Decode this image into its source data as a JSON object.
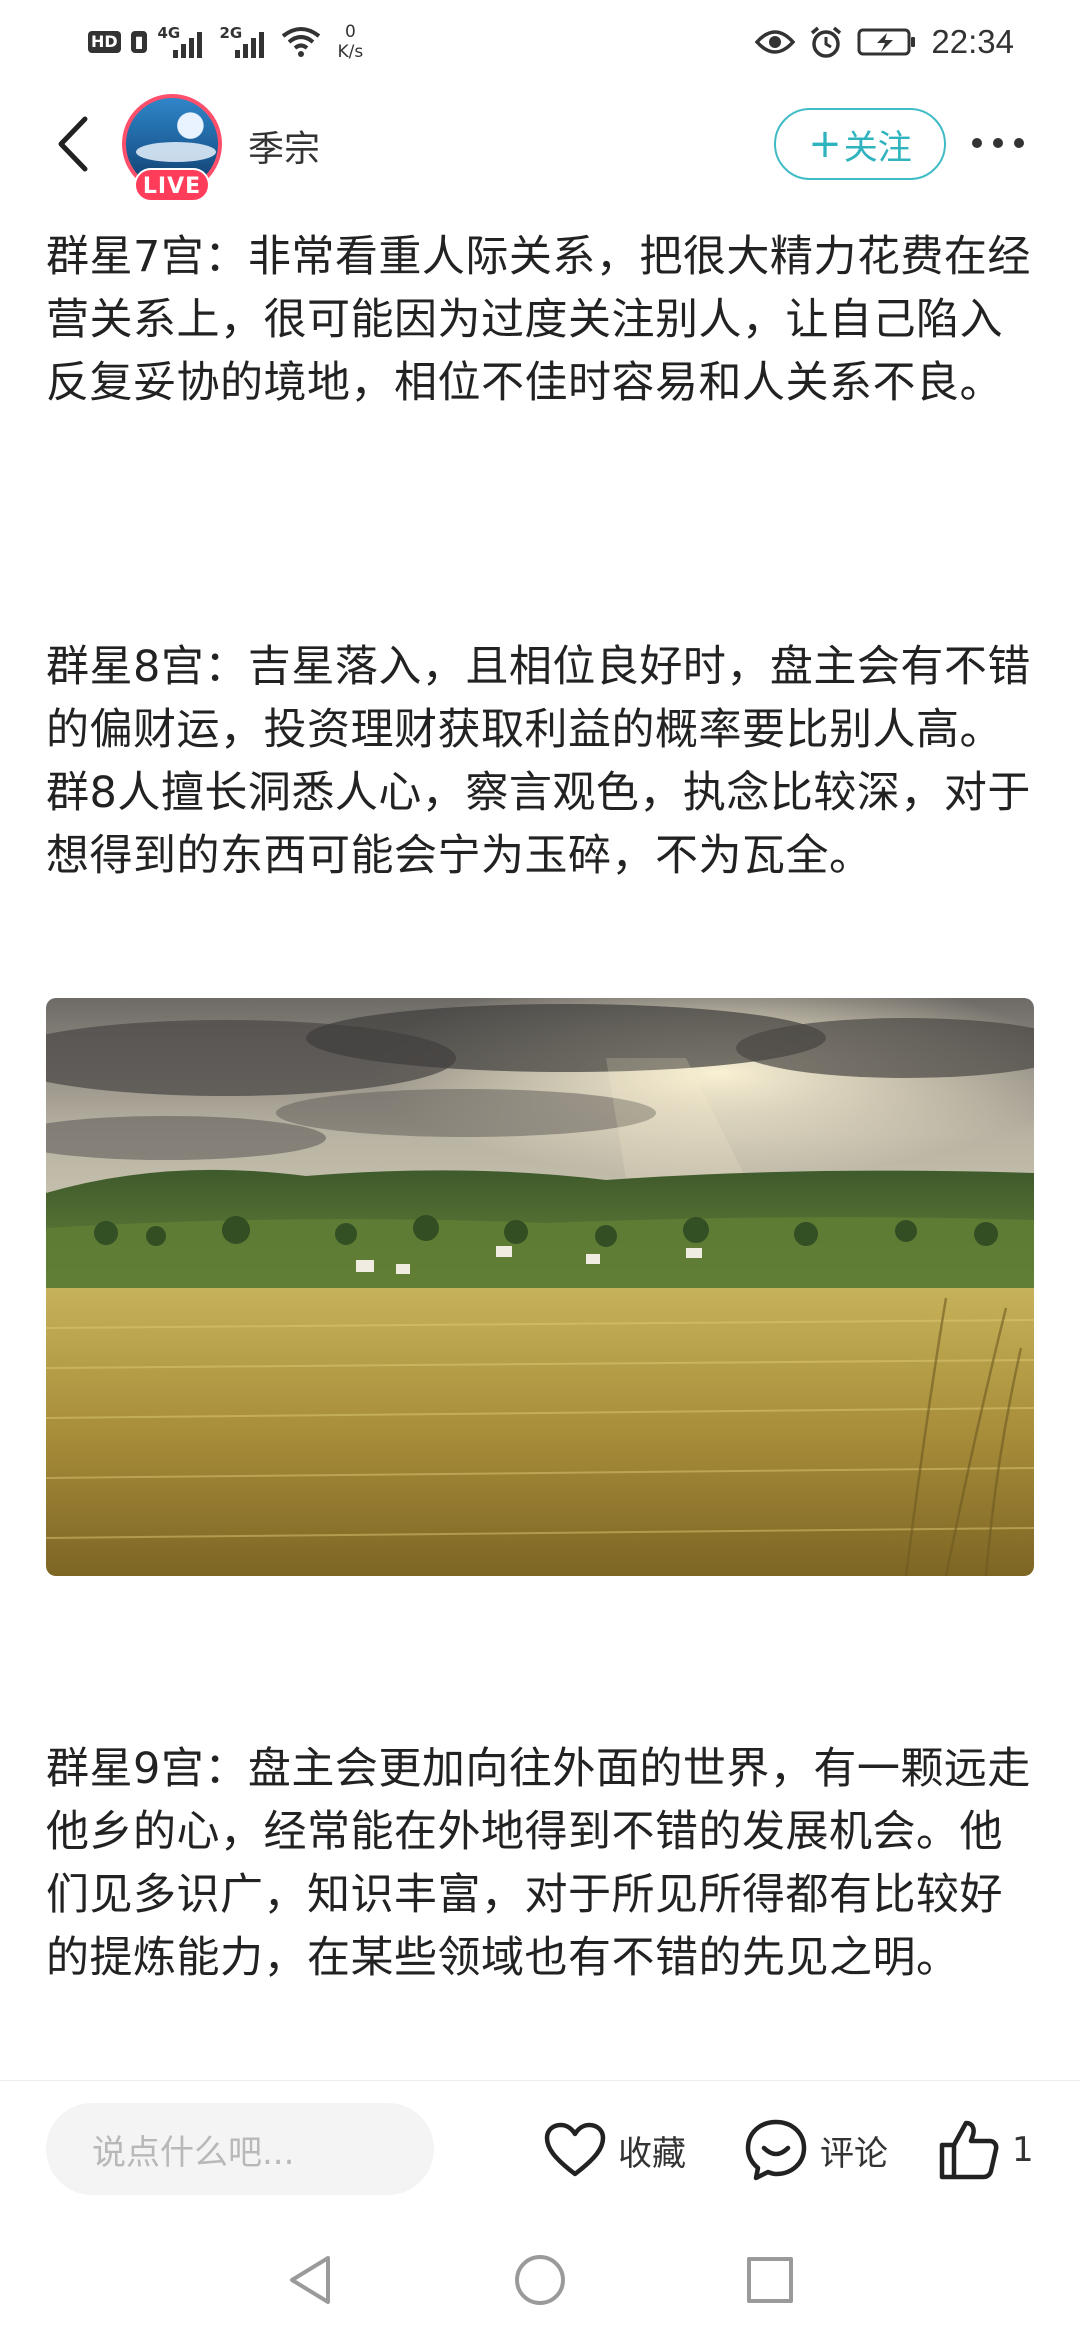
{
  "status_bar": {
    "hd_label": "HD",
    "sim1_type": "4G",
    "sim2_type": "2G",
    "net_speed_value": "0",
    "net_speed_unit": "K/s",
    "time": "22:34"
  },
  "header": {
    "author_name": "季宗",
    "live_label": "LIVE",
    "follow_label": "关注",
    "follow_plus": "+"
  },
  "article": {
    "para_7": "群星7宫：非常看重人际关系，把很大精力花费在经营关系上，很可能因为过度关注别人，让自己陷入反复妥协的境地，相位不佳时容易和人关系不良。",
    "para_8": "群星8宫：吉星落入，且相位良好时，盘主会有不错的偏财运，投资理财获取利益的概率要比别人高。群8人擅长洞悉人心，察言观色，执念比较深，对于想得到的东西可能会宁为玉碎，不为瓦全。",
    "para_9": "群星9宫：盘主会更加向往外面的世界，有一颗远走他乡的心，经常能在外地得到不错的发展机会。他们见多识广，知识丰富，对于所见所得都有比较好的提炼能力，在某些领域也有不错的先见之明。"
  },
  "action_bar": {
    "comment_placeholder": "说点什么吧...",
    "collect_label": "收藏",
    "comment_label": "评论",
    "like_count": "1"
  },
  "colors": {
    "accent_teal": "#2eb3bf",
    "live_red": "#ff3d5a",
    "text_dark": "#222222"
  }
}
